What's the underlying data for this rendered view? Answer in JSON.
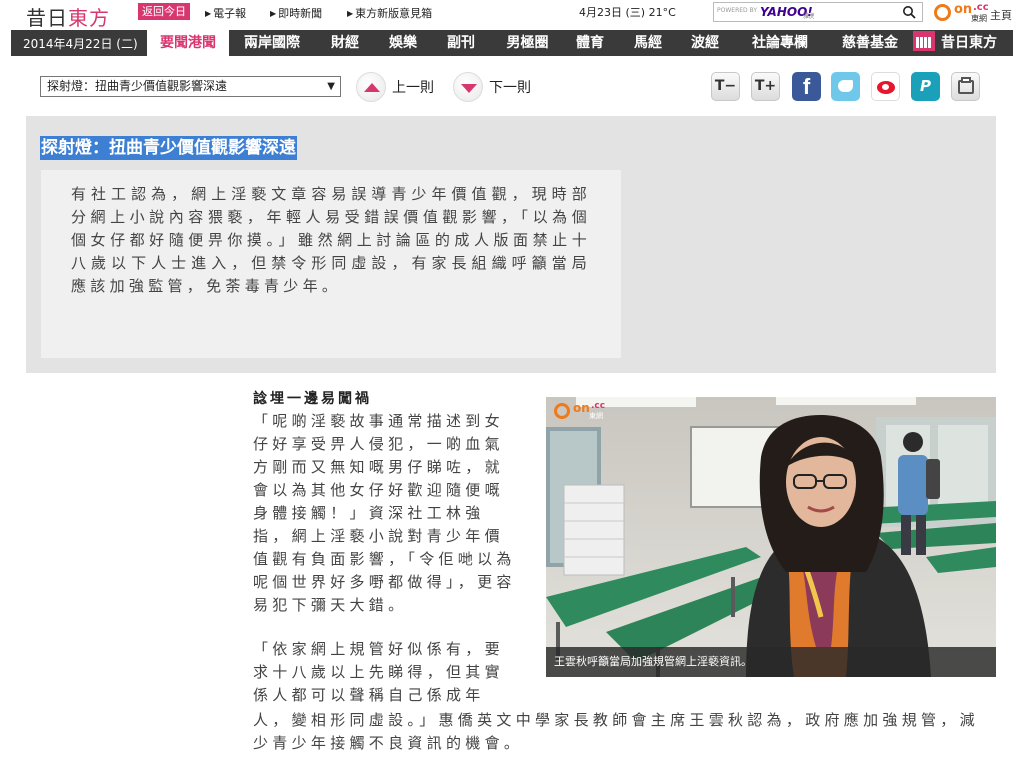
{
  "topbar": {
    "logo_part1": "昔日",
    "logo_part2": "東方",
    "back_today": "返回今日",
    "links": [
      "電子報",
      "即時新聞",
      "東方新版意見箱"
    ],
    "date_weather": "4月23日 (三) 21°C",
    "search": {
      "powered_by": "POWERED BY",
      "brand": "YAHOO!",
      "brand_sub": "雅虎香港",
      "placeholder": ""
    },
    "oncc": {
      "on": "on",
      "cc": ".cc",
      "dw": "東網",
      "home": "主頁"
    }
  },
  "nav": {
    "date": "2014年4月22日 (二)",
    "items": [
      "要聞港聞",
      "兩岸國際",
      "財經",
      "娛樂",
      "副刊",
      "男極圈",
      "體育",
      "馬經",
      "波經",
      "社論專欄",
      "慈善基金",
      "昔日東方"
    ],
    "active_index": 0
  },
  "toolbar": {
    "select_value": "探射燈：扭曲青少價值觀影響深遠",
    "prev_label": "上一則",
    "next_label": "下一則",
    "font_minus": "T−",
    "font_plus": "T+",
    "facebook": "f",
    "pinterest": "P"
  },
  "article": {
    "headline": "探射燈：扭曲青少價值觀影響深遠",
    "lead": "有社工認為，網上淫褻文章容易誤導青少年價值觀，現時部分網上小說內容猥褻，年輕人易受錯誤價值觀影響，「以為個個女仔都好隨便畀你摸。」雖然網上討論區的成人版面禁止十八歲以下人士進入，但禁令形同虛設，有家長組織呼籲當局應該加強監管，免荼毒青少年。",
    "subhead": "諗埋一邊易闖禍",
    "para1": "「呢啲淫褻故事通常描述到女仔好享受畀人侵犯，一啲血氣方剛而又無知嘅男仔睇咗，就會以為其他女仔好歡迎隨便嘅身體接觸！」資深社工林強指，網上淫褻小說對青少年價值觀有負面影響，「令佢哋以為呢個世界好多嘢都做得」，更容易犯下彌天大錯。",
    "para2_narrow": "「依家網上規管好似係有，要求十八歲以上先睇得，但其實係人都可以聲稱自己係成年",
    "para2_wide": "人，變相形同虛設。」惠僑英文中學家長教師會主席王雲秋認為，政府應加強規管，減少青少年接觸不良資訊的機會。",
    "photo_caption": "王雲秋呼籲當局加強規管網上淫褻資訊。",
    "photo_watermark": {
      "on": "on",
      "cc": ".cc",
      "dw": "東網"
    }
  },
  "colors": {
    "brand_pink": "#d8366e",
    "nav_bg": "#3a3a3a",
    "headline_bg": "#3d7fd3",
    "lead_bg": "#e3e3e3"
  }
}
